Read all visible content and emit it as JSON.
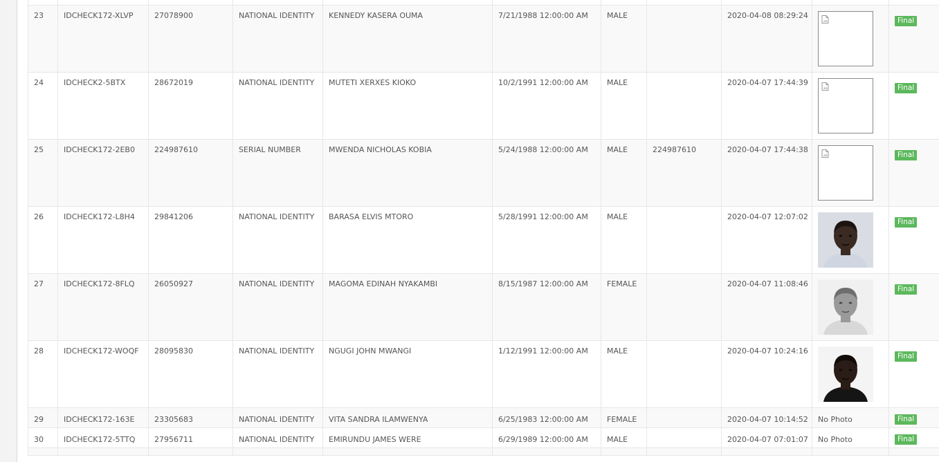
{
  "rows": [
    {
      "no": "23",
      "ref": "IDCHECK172-XLVP",
      "id_number": "27078900",
      "id_type": "NATIONAL IDENTITY",
      "name": "KENNEDY KASERA OUMA",
      "dob": "7/21/1988 12:00:00 AM",
      "gender": "MALE",
      "serial": "",
      "date": "2020-04-08 08:29:24",
      "photo": "broken",
      "status": "Final"
    },
    {
      "no": "24",
      "ref": "IDCHECK2-5BTX",
      "id_number": "28672019",
      "id_type": "NATIONAL IDENTITY",
      "name": "MUTETI XERXES KIOKO",
      "dob": "10/2/1991 12:00:00 AM",
      "gender": "MALE",
      "serial": "",
      "date": "2020-04-07 17:44:39",
      "photo": "broken",
      "status": "Final"
    },
    {
      "no": "25",
      "ref": "IDCHECK172-2EB0",
      "id_number": "224987610",
      "id_type": "SERIAL NUMBER",
      "name": "MWENDA NICHOLAS KOBIA",
      "dob": "5/24/1988 12:00:00 AM",
      "gender": "MALE",
      "serial": "224987610",
      "date": "2020-04-07 17:44:38",
      "photo": "broken",
      "status": "Final"
    },
    {
      "no": "26",
      "ref": "IDCHECK172-L8H4",
      "id_number": "29841206",
      "id_type": "NATIONAL IDENTITY",
      "name": "BARASA ELVIS MTORO",
      "dob": "5/28/1991 12:00:00 AM",
      "gender": "MALE",
      "serial": "",
      "date": "2020-04-07 12:07:02",
      "photo": "color",
      "status": "Final"
    },
    {
      "no": "27",
      "ref": "IDCHECK172-8FLQ",
      "id_number": "26050927",
      "id_type": "NATIONAL IDENTITY",
      "name": "MAGOMA EDINAH NYAKAMBI",
      "dob": "8/15/1987 12:00:00 AM",
      "gender": "FEMALE",
      "serial": "",
      "date": "2020-04-07 11:08:46",
      "photo": "gray",
      "status": "Final"
    },
    {
      "no": "28",
      "ref": "IDCHECK172-WOQF",
      "id_number": "28095830",
      "id_type": "NATIONAL IDENTITY",
      "name": "NGUGI JOHN MWANGI",
      "dob": "1/12/1991 12:00:00 AM",
      "gender": "MALE",
      "serial": "",
      "date": "2020-04-07 10:24:16",
      "photo": "dark",
      "status": "Final"
    },
    {
      "no": "29",
      "ref": "IDCHECK172-163E",
      "id_number": "23305683",
      "id_type": "NATIONAL IDENTITY",
      "name": "VITA SANDRA ILAMWENYA",
      "dob": "6/25/1983 12:00:00 AM",
      "gender": "FEMALE",
      "serial": "",
      "date": "2020-04-07 10:14:52",
      "photo": "none",
      "photo_text": "No Photo",
      "status": "Final"
    },
    {
      "no": "30",
      "ref": "IDCHECK172-5TTQ",
      "id_number": "27956711",
      "id_type": "NATIONAL IDENTITY",
      "name": "EMIRUNDU JAMES WERE",
      "dob": "6/29/1989 12:00:00 AM",
      "gender": "MALE",
      "serial": "",
      "date": "2020-04-07 07:01:07",
      "photo": "none",
      "photo_text": "No Photo",
      "status": "Final"
    }
  ],
  "colors": {
    "badge": "#5cb85c",
    "row_stripe": "#f9f9f9",
    "border": "#e7e7e7",
    "page_bg": "#f3f3f4"
  }
}
